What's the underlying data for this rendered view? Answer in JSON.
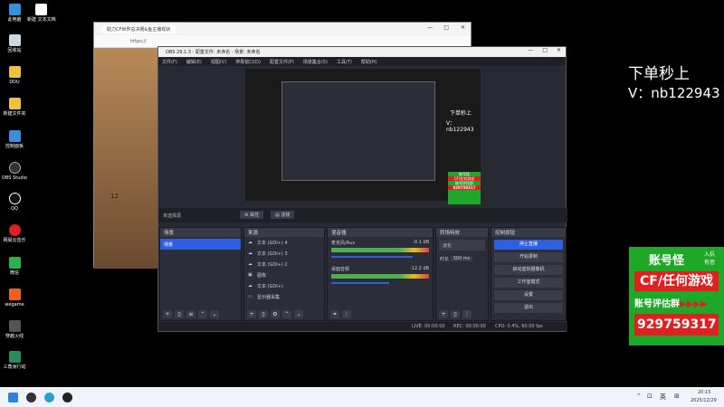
{
  "desktop": {
    "icons": [
      "此电脑",
      "新建 文本文档",
      "回收站",
      "DDU",
      "新建文件夹",
      "控制面板",
      "OBS Studio",
      "QQ",
      "网易云音乐",
      "微信",
      "wegame",
      "穿越火线",
      "三角洲行动"
    ]
  },
  "browser": {
    "tab_title": "助力CF世界总决赛&鱼主播现状",
    "url": "https://",
    "site_counts": "12"
  },
  "obs": {
    "title": "OBS 29.1.3 - 配置文件: 未命名 - 场景: 未命名",
    "menu": [
      "文件(F)",
      "编辑(E)",
      "视图(V)",
      "停靠窗口(D)",
      "配置文件(P)",
      "场景集合(S)",
      "工具(T)",
      "帮助(H)"
    ],
    "no_source": "未选择源",
    "props": "属性",
    "filters": "滤镜",
    "scenes_title": "场景",
    "scenes": [
      "场景"
    ],
    "sources_title": "来源",
    "sources": [
      "文本 (GDI+) 4",
      "文本 (GDI+) 3",
      "文本 (GDI+) 2",
      "图像",
      "文本 (GDI+)",
      "显示器采集"
    ],
    "mixer_title": "混音器",
    "mixer": [
      {
        "name": "麦克风/Aux",
        "db": "-0.1 dB"
      },
      {
        "name": "桌面音频",
        "db": "-12.2 dB"
      }
    ],
    "trans_title": "转场特效",
    "trans_type": "淡化",
    "duration_label": "时长",
    "duration": "300 ms",
    "ctrl_title": "控制按钮",
    "controls": [
      "停止直播",
      "开始录制",
      "启动虚拟摄像机",
      "工作室模式",
      "设置",
      "退出"
    ],
    "status": {
      "live": "LIVE: 00:00:00",
      "rec": "REC: 00:00:00",
      "cpu": "CPU: 0.4%, 60.00 fps"
    }
  },
  "overlay": {
    "line1": "下单秒上",
    "line2": "V：nb122943"
  },
  "preview_text": {
    "line1": "下单秒上",
    "line2": "V：nb122943"
  },
  "ad": {
    "top": "账号怪",
    "badge1": "入抗",
    "badge2": "有惩",
    "mid": "CF/任何游戏",
    "lower": "账号评估群",
    "arrows": "▶▶▶▶",
    "qq": "929759317"
  },
  "preview_ad": {
    "l1": "账号怪",
    "l2": "CF/任何游戏",
    "l3": "账号评估群",
    "qq": "929759317"
  },
  "taskbar": {
    "lang": "英",
    "time": "20:15",
    "date": "2025/12/29"
  },
  "colors": {
    "accent": "#2f5ee0",
    "green": "#1fa828",
    "red": "#e02020"
  }
}
